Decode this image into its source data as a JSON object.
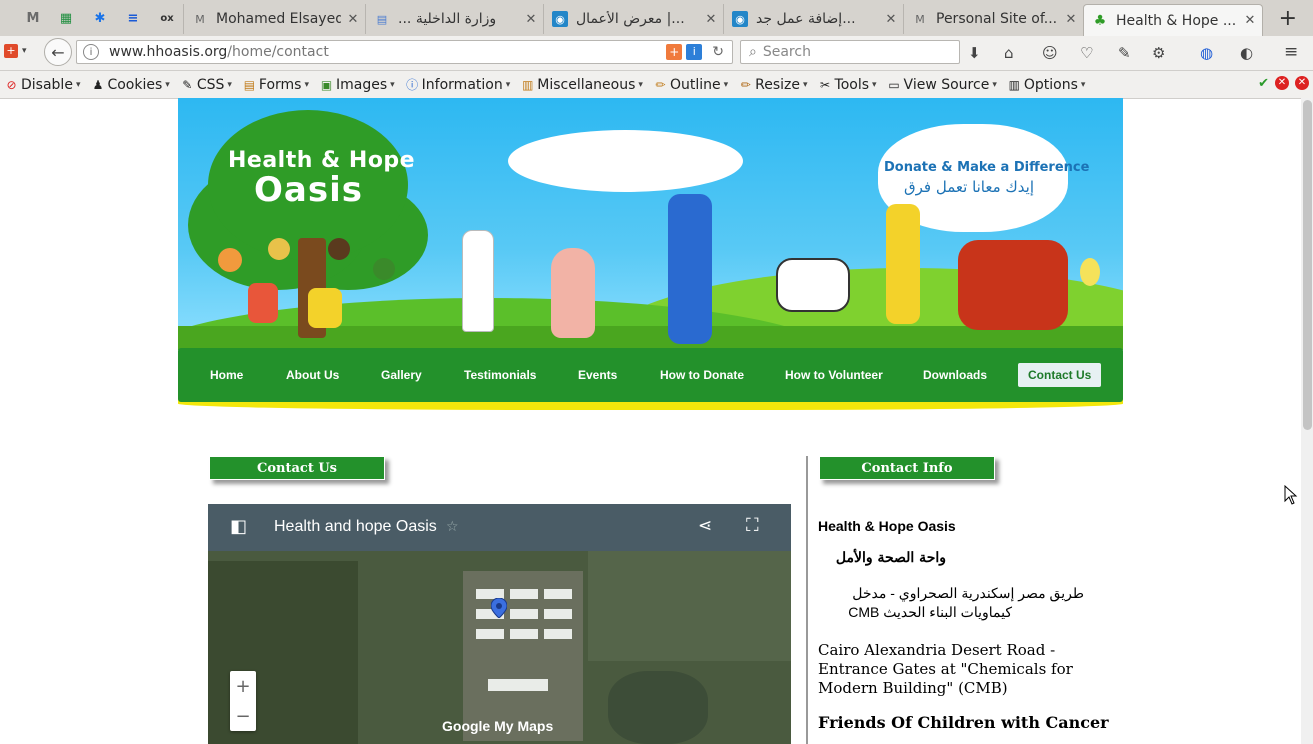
{
  "browser": {
    "pinned_tabs": [
      {
        "icon": "gmail-icon",
        "glyph": "M",
        "color": "#6b6b6b"
      },
      {
        "icon": "sheets-icon",
        "glyph": "▦",
        "color": "#1e8e3e"
      },
      {
        "icon": "asterisk-icon",
        "glyph": "✱",
        "color": "#1a73e8"
      },
      {
        "icon": "docs-icon",
        "glyph": "≡",
        "color": "#1a5ad6"
      },
      {
        "icon": "olx-icon",
        "glyph": "ox",
        "color": "#333333"
      }
    ],
    "tabs": [
      {
        "title": "Mohamed Elsayed ...",
        "icon": "m-icon"
      },
      {
        "title": "... وزارة الداخلية",
        "icon": "doc-icon"
      },
      {
        "title": "معرض الأعمال |...",
        "icon": "mostaql-icon"
      },
      {
        "title": "إضافة عمل جد...",
        "icon": "mostaql-icon"
      },
      {
        "title": "Personal Site of...",
        "icon": "m-icon"
      },
      {
        "title": "Health & Hope ...",
        "icon": "tree-icon",
        "active": true
      }
    ],
    "url_host": "www.hhoasis.org",
    "url_path": "/home/contact",
    "search_placeholder": "Search"
  },
  "devtoolbar": {
    "items": [
      "Disable",
      "Cookies",
      "CSS",
      "Forms",
      "Images",
      "Information",
      "Miscellaneous",
      "Outline",
      "Resize",
      "Tools",
      "View Source",
      "Options"
    ]
  },
  "site": {
    "logo_line1": "Health & Hope",
    "logo_line2": "Oasis",
    "donate_en": "Donate & Make a Difference",
    "donate_ar": "إيدك معانا تعمل فرق",
    "menu": [
      "Home",
      "About Us",
      "Gallery",
      "Testimonials",
      "Events",
      "How to Donate",
      "How to Volunteer",
      "Downloads",
      "Contact Us"
    ],
    "active_menu": "Contact Us"
  },
  "content": {
    "contact_us_heading": "Contact Us",
    "contact_info_heading": "Contact Info",
    "map_title": "Health and hope Oasis",
    "map_watermark": "Google My Maps",
    "org_name_en": "Health & Hope Oasis",
    "org_name_ar": "واحة الصحة والأمل",
    "address_ar_line1": "طريق مصر إسكندرية الصحراوي - مدخل",
    "address_ar_line2": "كيماويات البناء الحديث  CMB",
    "address_en_line1": "Cairo Alexandria Desert Road -",
    "address_en_line2": "Entrance Gates at \"Chemicals for",
    "address_en_line3": "Modern Building\" (CMB)",
    "friends_heading": "Friends Of Children with Cancer"
  },
  "colors": {
    "menu_green": "#23912b",
    "sky_blue": "#2db8f2",
    "yellow_trim": "#f3e70b"
  }
}
